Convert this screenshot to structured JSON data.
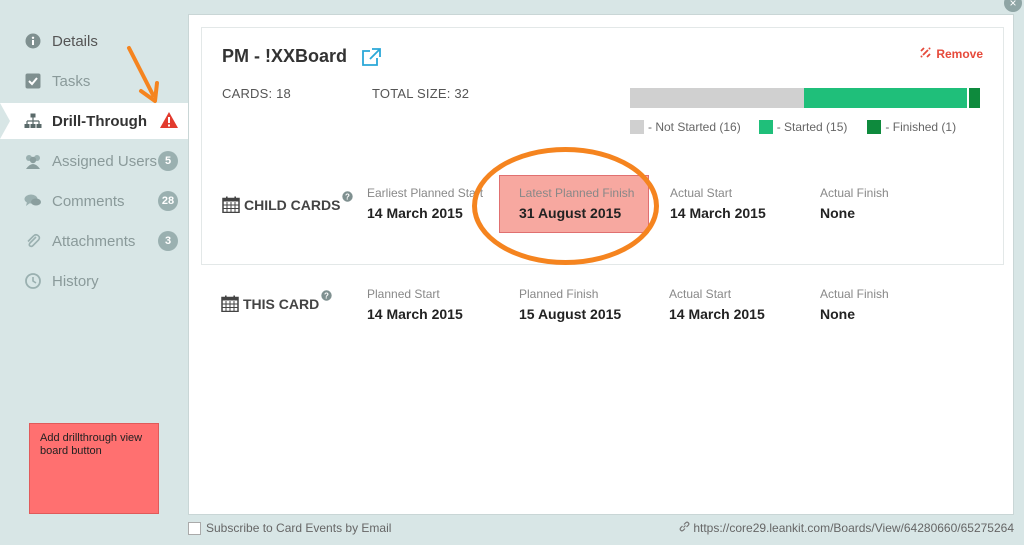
{
  "sidebar": {
    "items": [
      {
        "label": "Details",
        "icon": "info-icon"
      },
      {
        "label": "Tasks",
        "icon": "checkbox-icon"
      },
      {
        "label": "Drill-Through",
        "icon": "sitemap-icon"
      },
      {
        "label": "Assigned Users",
        "icon": "users-icon",
        "badge": "5"
      },
      {
        "label": "Comments",
        "icon": "comments-icon",
        "badge": "28"
      },
      {
        "label": "Attachments",
        "icon": "paperclip-icon",
        "badge": "3"
      },
      {
        "label": "History",
        "icon": "clock-icon"
      }
    ]
  },
  "note": {
    "text": "Add drillthrough view board button"
  },
  "card": {
    "title": "PM - !XXBoard",
    "remove_label": "Remove",
    "cards_stat": "CARDS: 18",
    "total_size_stat": "TOTAL SIZE: 32",
    "progress": {
      "not_started": 16,
      "started": 15,
      "finished": 1,
      "colors": {
        "not_started": "#d0d0d0",
        "started": "#1fbf7a",
        "finished": "#0e8a3d"
      }
    },
    "legend": {
      "not_started": "- Not Started (16)",
      "started": "- Started (15)",
      "finished": "- Finished (1)"
    },
    "child_cards": {
      "label": "CHILD CARDS",
      "cols": [
        {
          "label": "Earliest Planned Start",
          "value": "14 March 2015"
        },
        {
          "label": "Latest Planned Finish",
          "value": "31 August 2015"
        },
        {
          "label": "Actual Start",
          "value": "14 March 2015"
        },
        {
          "label": "Actual Finish",
          "value": "None"
        }
      ]
    },
    "this_card": {
      "label": "THIS CARD",
      "cols": [
        {
          "label": "Planned Start",
          "value": "14 March 2015"
        },
        {
          "label": "Planned Finish",
          "value": "15 August 2015"
        },
        {
          "label": "Actual Start",
          "value": "14 March 2015"
        },
        {
          "label": "Actual Finish",
          "value": "None"
        }
      ]
    }
  },
  "footer": {
    "subscribe_label": "Subscribe to Card Events by Email",
    "url": "https://core29.leankit.com/Boards/View/64280660/65275264"
  },
  "close_label": "×"
}
